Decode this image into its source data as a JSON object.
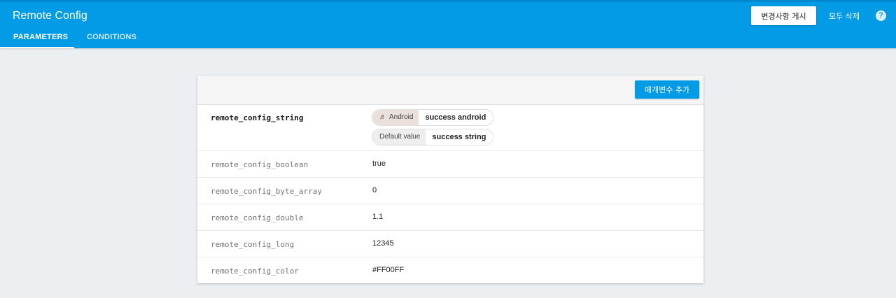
{
  "header": {
    "title": "Remote Config",
    "tabs": [
      {
        "label": "PARAMETERS",
        "active": true
      },
      {
        "label": "CONDITIONS",
        "active": false
      }
    ],
    "publish_label": "변경사항 게시",
    "delete_all_label": "모두 삭제",
    "help_glyph": "?"
  },
  "toolbar": {
    "add_parameter_label": "매개변수 추가"
  },
  "parameters": [
    {
      "key": "remote_config_string",
      "conditional_values": [
        {
          "condition": "Android",
          "value": "success android",
          "icon": "android-icon"
        }
      ],
      "default_label": "Default value",
      "default_value": "success string"
    },
    {
      "key": "remote_config_boolean",
      "value": "true"
    },
    {
      "key": "remote_config_byte_array",
      "value": "0"
    },
    {
      "key": "remote_config_double",
      "value": "1.1"
    },
    {
      "key": "remote_config_long",
      "value": "12345"
    },
    {
      "key": "remote_config_color",
      "value": "#FF00FF"
    }
  ],
  "colors": {
    "brand": "#039be5",
    "page_background": "#eceff1",
    "android_chip": "#eae0dc"
  }
}
